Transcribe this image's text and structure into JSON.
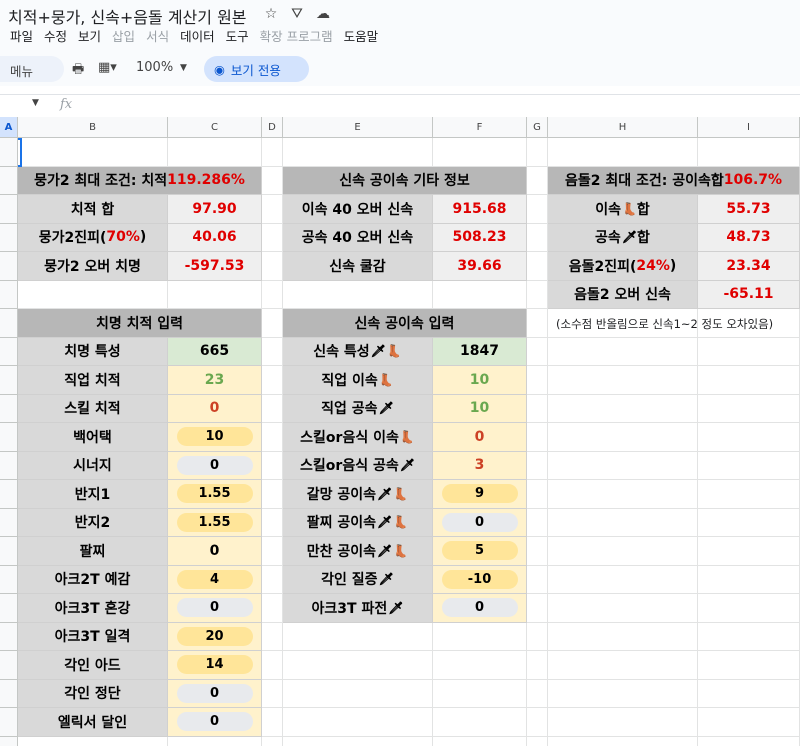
{
  "title": "치적+뭉가, 신속+음돌 계산기 원본",
  "menus": [
    "파일",
    "수정",
    "보기",
    "삽입",
    "서식",
    "데이터",
    "도구",
    "확장 프로그램",
    "도움말"
  ],
  "menus_disabled": [
    3,
    4,
    7
  ],
  "toolbar": {
    "menu_label": "메뉴",
    "zoom": "100%",
    "view_only": "보기 전용"
  },
  "col_headers": [
    "A",
    "B",
    "C",
    "D",
    "E",
    "F",
    "G",
    "H",
    "I"
  ],
  "block1": {
    "header_label": "뭉가2 최대 조건: 치적 ",
    "header_value": "119.286%",
    "rows": [
      {
        "label": "치적 합",
        "value": "97.90"
      },
      {
        "label_pre": "뭉가2진피(",
        "label_red": "70%",
        "label_post": ")",
        "value": "40.06"
      },
      {
        "label": "뭉가2 오버 치명",
        "value": "-597.53"
      }
    ]
  },
  "block2": {
    "header": "신속 공이속 기타 정보",
    "rows": [
      {
        "label": "이속 40 오버 신속",
        "value": "915.68"
      },
      {
        "label": "공속 40 오버 신속",
        "value": "508.23"
      },
      {
        "label": "신속 쿨감",
        "value": "39.66"
      }
    ]
  },
  "block3": {
    "header_label": "음돌2 최대 조건: 공이속합 ",
    "header_value": "106.7%",
    "rows": [
      {
        "label": "이속",
        "icon": "boot",
        "label_post": " 합",
        "value": "55.73"
      },
      {
        "label": "공속",
        "icon": "dagger",
        "label_post": " 합",
        "value": "48.73"
      },
      {
        "label_pre": "음돌2진피(",
        "label_red": "24%",
        "label_post": ")",
        "value": "23.34"
      },
      {
        "label": "음돌2 오버 신속",
        "value": "-65.11"
      }
    ],
    "note": "(소수점 반올림으로 신속1~2 정도 오차있음)"
  },
  "input1": {
    "header": "치명 치적 입력",
    "rows": [
      {
        "label": "치명 특성",
        "value": "665",
        "style": "green-bg"
      },
      {
        "label": "직업 치적",
        "value": "23",
        "style": "green-text"
      },
      {
        "label": "스킬 치적",
        "value": "0",
        "style": "orange-text"
      },
      {
        "label": "백어택",
        "value": "10",
        "style": "chip-y"
      },
      {
        "label": "시너지",
        "value": "0",
        "style": "chip-g"
      },
      {
        "label": "반지1",
        "value": "1.55",
        "style": "chip-y"
      },
      {
        "label": "반지2",
        "value": "1.55",
        "style": "chip-y"
      },
      {
        "label": "팔찌",
        "value": "0",
        "style": "plain"
      },
      {
        "label": "아크2T 예감",
        "value": "4",
        "style": "chip-y"
      },
      {
        "label": "아크3T 혼강",
        "value": "0",
        "style": "chip-g"
      },
      {
        "label": "아크3T 일격",
        "value": "20",
        "style": "chip-y"
      },
      {
        "label": "각인 아드",
        "value": "14",
        "style": "chip-y"
      },
      {
        "label": "각인 정단",
        "value": "0",
        "style": "chip-g"
      },
      {
        "label": "엘릭서 달인",
        "value": "0",
        "style": "chip-g"
      }
    ]
  },
  "input2": {
    "header": "신속 공이속 입력",
    "rows": [
      {
        "label": "신속 특성",
        "icons": [
          "dagger",
          "boot"
        ],
        "value": "1847",
        "style": "green-bg"
      },
      {
        "label": "직업 이속",
        "icons": [
          "boot"
        ],
        "value": "10",
        "style": "green-text"
      },
      {
        "label": "직업 공속",
        "icons": [
          "dagger"
        ],
        "value": "10",
        "style": "green-text"
      },
      {
        "label": "스킬or음식 이속",
        "icons": [
          "boot"
        ],
        "value": "0",
        "style": "orange-text"
      },
      {
        "label": "스킬or음식 공속",
        "icons": [
          "dagger"
        ],
        "value": "3",
        "style": "orange-text"
      },
      {
        "label": "갈망 공이속",
        "icons": [
          "dagger",
          "boot"
        ],
        "value": "9",
        "style": "chip-y"
      },
      {
        "label": "팔찌 공이속",
        "icons": [
          "dagger",
          "boot"
        ],
        "value": "0",
        "style": "chip-g"
      },
      {
        "label": "만찬 공이속",
        "icons": [
          "dagger",
          "boot"
        ],
        "value": "5",
        "style": "chip-y"
      },
      {
        "label": "각인 질증",
        "icons": [
          "dagger"
        ],
        "value": "-10",
        "style": "chip-y"
      },
      {
        "label": "아크3T 파전",
        "icons": [
          "dagger"
        ],
        "value": "0",
        "style": "chip-g"
      }
    ]
  },
  "icons": {
    "boot": "👢",
    "dagger": "🗡"
  }
}
